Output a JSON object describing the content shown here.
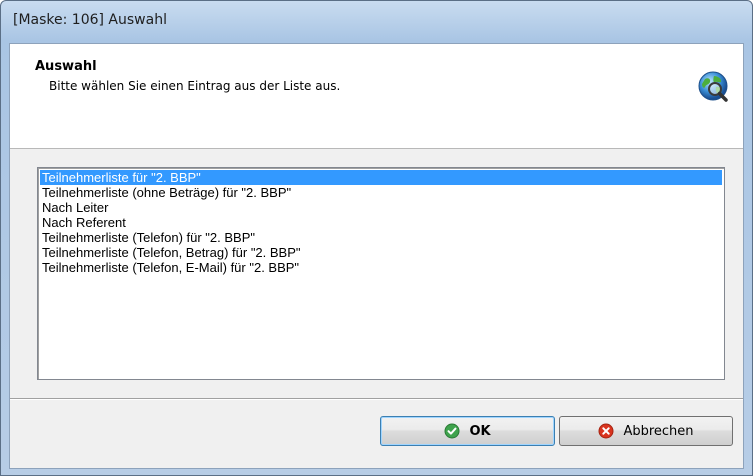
{
  "window": {
    "title": "[Maske: 106] Auswahl"
  },
  "header": {
    "title": "Auswahl",
    "subtitle": "Bitte wählen Sie einen Eintrag aus der Liste aus.",
    "icon": "globe-search-icon"
  },
  "list": {
    "items": [
      {
        "label": "Teilnehmerliste für \"2. BBP\"",
        "selected": true
      },
      {
        "label": "Teilnehmerliste (ohne Beträge) für \"2. BBP\"",
        "selected": false
      },
      {
        "label": "Nach Leiter",
        "selected": false
      },
      {
        "label": "Nach Referent",
        "selected": false
      },
      {
        "label": "Teilnehmerliste (Telefon) für \"2. BBP\"",
        "selected": false
      },
      {
        "label": "Teilnehmerliste (Telefon, Betrag) für \"2. BBP\"",
        "selected": false
      },
      {
        "label": "Teilnehmerliste (Telefon, E-Mail) für \"2. BBP\"",
        "selected": false
      }
    ]
  },
  "buttons": {
    "ok_label": "OK",
    "ok_icon": "check-circle-icon",
    "cancel_label": "Abbrechen",
    "cancel_icon": "x-circle-icon"
  },
  "colors": {
    "selection": "#3399ff",
    "ok_icon": "#3fa34d",
    "cancel_icon": "#d9341f"
  }
}
